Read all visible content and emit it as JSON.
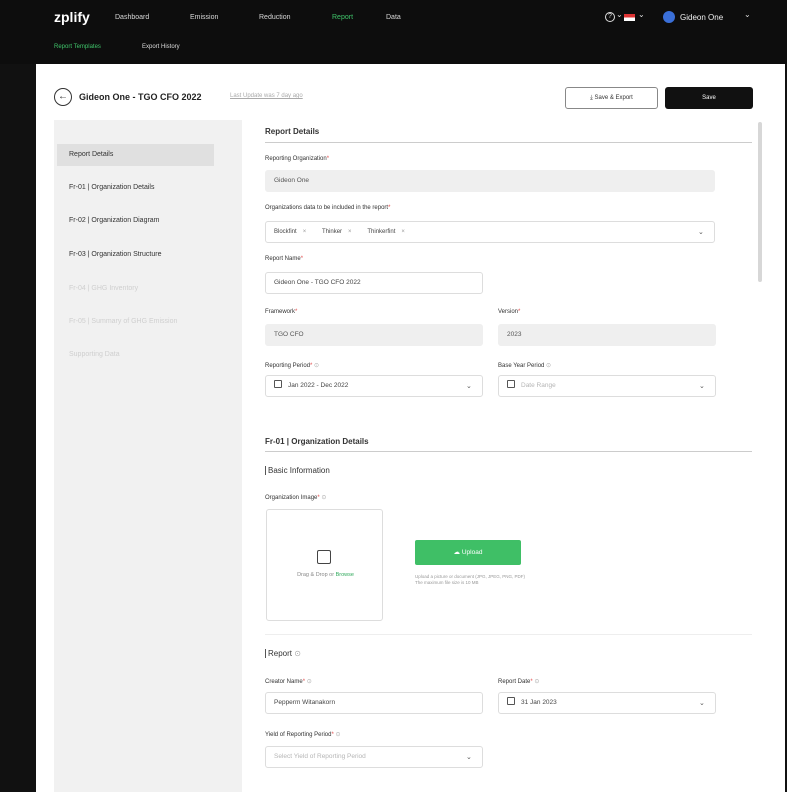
{
  "brand": {
    "logo": "zplify"
  },
  "nav": {
    "items": [
      "Dashboard",
      "Emission",
      "Reduction",
      "Report",
      "Data"
    ],
    "active": "Report",
    "sub_items": [
      "Report Templates",
      "Export History"
    ],
    "user_name": "Gideon One",
    "help_glyph": "?",
    "chevron": "⌄"
  },
  "header": {
    "title": "Gideon One - TGO CFO 2022",
    "last_update": "Last Update was 7 day ago",
    "export_label": "Save & Export",
    "export_glyph": "⤓",
    "save_label": "Save",
    "back_glyph": "←"
  },
  "sidebar": {
    "items": [
      "Report Details",
      "Fr-01 | Organization Details",
      "Fr-02 | Organization Diagram",
      "Fr-03 | Organization Structure",
      "Fr-04 | GHG Inventory",
      "Fr-05 | Summary of GHG Emission",
      "Supporting Data"
    ]
  },
  "form": {
    "section1_title": "Report Details",
    "reporting_org_label": "Reporting Organization",
    "reporting_org_value": "Gideon One",
    "orgs_label": "Organizations data to be included in the report",
    "orgs_chips": [
      "Blockfint",
      "Thinker",
      "Thinkerfint"
    ],
    "report_name_label": "Report Name",
    "report_name_value": "Gideon One - TGO CFO 2022",
    "framework_label": "Framework",
    "framework_value": "TGO CFO",
    "version_label": "Version",
    "version_value": "2023",
    "reporting_period_label": "Reporting Period",
    "reporting_period_value": "Jan 2022 - Dec 2022",
    "base_year_label": "Base Year Period",
    "base_year_placeholder": "Date Range",
    "section2_title": "Fr-01 | Organization Details",
    "basic_info_title": "Basic Information",
    "org_image_label": "Organization Image",
    "drag_text": "Drag & Drop or",
    "browse_text": "Browse",
    "upload_label": "Upload",
    "upload_glyph": "☁",
    "upload_hint_1": "Upload a picture or document (JPG, JPEG, PNG, PDF)",
    "upload_hint_2": "The maximum file size is 10 MB",
    "report_title": "Report",
    "creator_label": "Creator Name",
    "creator_value": "Pepperm Witanakorn",
    "report_date_label": "Report Date",
    "report_date_value": "31 Jan 2023",
    "yield_label": "Yield of Reporting Period",
    "yield_placeholder": "Select Yield of Reporting Period",
    "req_mark": "*",
    "info_mark": "⊙",
    "chevron": "⌄",
    "chip_x": "×"
  }
}
